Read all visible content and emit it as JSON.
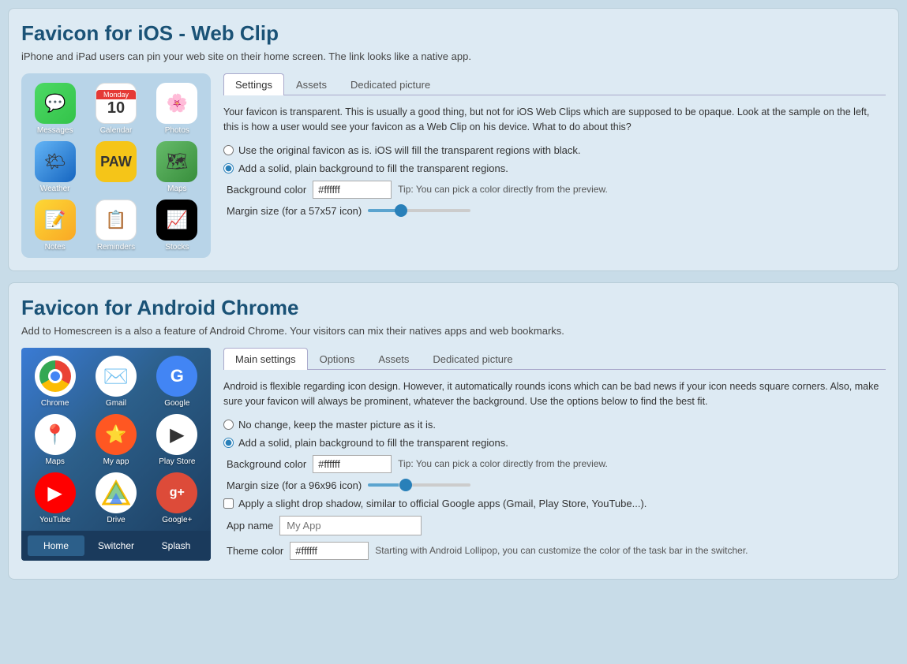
{
  "ios_section": {
    "title": "Favicon for iOS - Web Clip",
    "subtitle": "iPhone and iPad users can pin your web site on their home screen. The link looks like a native app.",
    "tabs": [
      {
        "id": "settings",
        "label": "Settings",
        "active": true
      },
      {
        "id": "assets",
        "label": "Assets",
        "active": false
      },
      {
        "id": "dedicated",
        "label": "Dedicated picture",
        "active": false
      }
    ],
    "settings_text": "Your favicon is transparent. This is usually a good thing, but not for iOS Web Clips which are supposed to be opaque. Look at the sample on the left, this is how a user would see your favicon as a Web Clip on his device. What to do about this?",
    "radio_options": [
      {
        "id": "original",
        "label": "Use the original favicon as is. iOS will fill the transparent regions with black.",
        "checked": false
      },
      {
        "id": "solid",
        "label": "Add a solid, plain background to fill the transparent regions.",
        "checked": true
      }
    ],
    "bg_color_label": "Background color",
    "bg_color_value": "#ffffff",
    "tip_text": "Tip: You can pick a color directly from the preview.",
    "margin_label": "Margin size (for a 57x57 icon)",
    "apps": [
      {
        "name": "Messages",
        "icon_class": "icon-messages",
        "emoji": "💬"
      },
      {
        "name": "Calendar",
        "icon_class": "icon-calendar",
        "type": "calendar"
      },
      {
        "name": "Photos",
        "icon_class": "icon-photos",
        "emoji": "🌸"
      },
      {
        "name": "Weather",
        "icon_class": "icon-weather",
        "emoji": "🌤"
      },
      {
        "name": "Paw",
        "icon_class": "icon-paw",
        "emoji": "🐾"
      },
      {
        "name": "Maps",
        "icon_class": "icon-maps",
        "emoji": "🗺"
      },
      {
        "name": "Notes",
        "icon_class": "icon-notes",
        "emoji": "📝"
      },
      {
        "name": "Reminders",
        "icon_class": "icon-reminders",
        "emoji": "📋"
      },
      {
        "name": "Stocks",
        "icon_class": "icon-stocks",
        "emoji": "📈"
      }
    ]
  },
  "android_section": {
    "title": "Favicon for Android Chrome",
    "subtitle": "Add to Homescreen is a also a feature of Android Chrome. Your visitors can mix their natives apps and web bookmarks.",
    "tabs": [
      {
        "id": "main",
        "label": "Main settings",
        "active": true
      },
      {
        "id": "options",
        "label": "Options",
        "active": false
      },
      {
        "id": "assets",
        "label": "Assets",
        "active": false
      },
      {
        "id": "dedicated",
        "label": "Dedicated picture",
        "active": false
      }
    ],
    "settings_text": "Android is flexible regarding icon design. However, it automatically rounds icons which can be bad news if your icon needs square corners. Also, make sure your favicon will always be prominent, whatever the background. Use the options below to find the best fit.",
    "radio_options": [
      {
        "id": "nochange",
        "label": "No change, keep the master picture as it is.",
        "checked": false
      },
      {
        "id": "solid",
        "label": "Add a solid, plain background to fill the transparent regions.",
        "checked": true
      }
    ],
    "bg_color_label": "Background color",
    "bg_color_value": "#ffffff",
    "tip_text": "Tip: You can pick a color directly from the preview.",
    "margin_label": "Margin size (for a 96x96 icon)",
    "shadow_label": "Apply a slight drop shadow, similar to official Google apps (Gmail, Play Store, YouTube...).",
    "app_name_label": "App name",
    "app_name_placeholder": "My App",
    "theme_color_label": "Theme color",
    "theme_color_value": "#ffffff",
    "theme_color_tip": "Starting with Android Lollipop, you can customize the color of the task bar in the switcher.",
    "taskbar_buttons": [
      {
        "label": "Home",
        "active": true
      },
      {
        "label": "Switcher",
        "active": false
      },
      {
        "label": "Splash",
        "active": false
      }
    ],
    "apps": [
      {
        "name": "Chrome",
        "icon_class": "icon-chrome",
        "type": "chrome"
      },
      {
        "name": "Gmail",
        "icon_class": "icon-gmail",
        "emoji": "✉️"
      },
      {
        "name": "Google",
        "icon_class": "icon-google",
        "emoji": "G"
      },
      {
        "name": "Maps",
        "icon_class": "icon-gmaps",
        "emoji": "📍"
      },
      {
        "name": "My app",
        "icon_class": "icon-myapp",
        "emoji": "⭐"
      },
      {
        "name": "Play Store",
        "icon_class": "icon-playstore",
        "emoji": "▶"
      },
      {
        "name": "YouTube",
        "icon_class": "icon-youtube",
        "emoji": "▶"
      },
      {
        "name": "Drive",
        "icon_class": "icon-drive",
        "emoji": "△"
      },
      {
        "name": "Google+",
        "icon_class": "icon-googleplus",
        "emoji": "g+"
      }
    ]
  }
}
